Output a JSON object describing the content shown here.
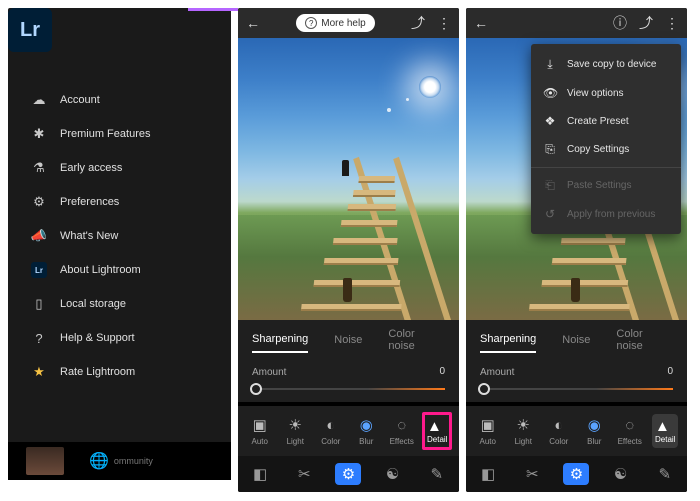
{
  "sidebar": {
    "logo": "Lr",
    "items": [
      {
        "icon": "cloud-icon",
        "label": "Account"
      },
      {
        "icon": "asterisk-icon",
        "label": "Premium Features"
      },
      {
        "icon": "flask-icon",
        "label": "Early access"
      },
      {
        "icon": "gear-icon",
        "label": "Preferences"
      },
      {
        "icon": "megaphone-icon",
        "label": "What's New"
      },
      {
        "icon": "lr-mini-icon",
        "label": "About Lightroom"
      },
      {
        "icon": "device-icon",
        "label": "Local storage"
      },
      {
        "icon": "help-icon",
        "label": "Help & Support"
      },
      {
        "icon": "star-icon",
        "label": "Rate Lightroom"
      }
    ],
    "footer_label": "ommunity"
  },
  "topbar": {
    "more_help": "More help"
  },
  "detail_panel": {
    "tabs": [
      "Sharpening",
      "Noise",
      "Color noise"
    ],
    "active_tab": 0,
    "amount_label": "Amount",
    "amount_value": "0"
  },
  "tools": [
    {
      "name": "auto",
      "label": "Auto"
    },
    {
      "name": "light",
      "label": "Light"
    },
    {
      "name": "color",
      "label": "Color"
    },
    {
      "name": "blur",
      "label": "Blur"
    },
    {
      "name": "effects",
      "label": "Effects"
    },
    {
      "name": "detail",
      "label": "Detail"
    }
  ],
  "context_menu": [
    {
      "icon": "download-icon",
      "label": "Save copy to device",
      "enabled": true
    },
    {
      "icon": "eye-icon",
      "label": "View options",
      "enabled": true
    },
    {
      "icon": "preset-icon",
      "label": "Create Preset",
      "enabled": true
    },
    {
      "icon": "copy-icon",
      "label": "Copy Settings",
      "enabled": true
    },
    {
      "icon": "paste-icon",
      "label": "Paste Settings",
      "enabled": false
    },
    {
      "icon": "apply-icon",
      "label": "Apply from previous",
      "enabled": false
    }
  ]
}
